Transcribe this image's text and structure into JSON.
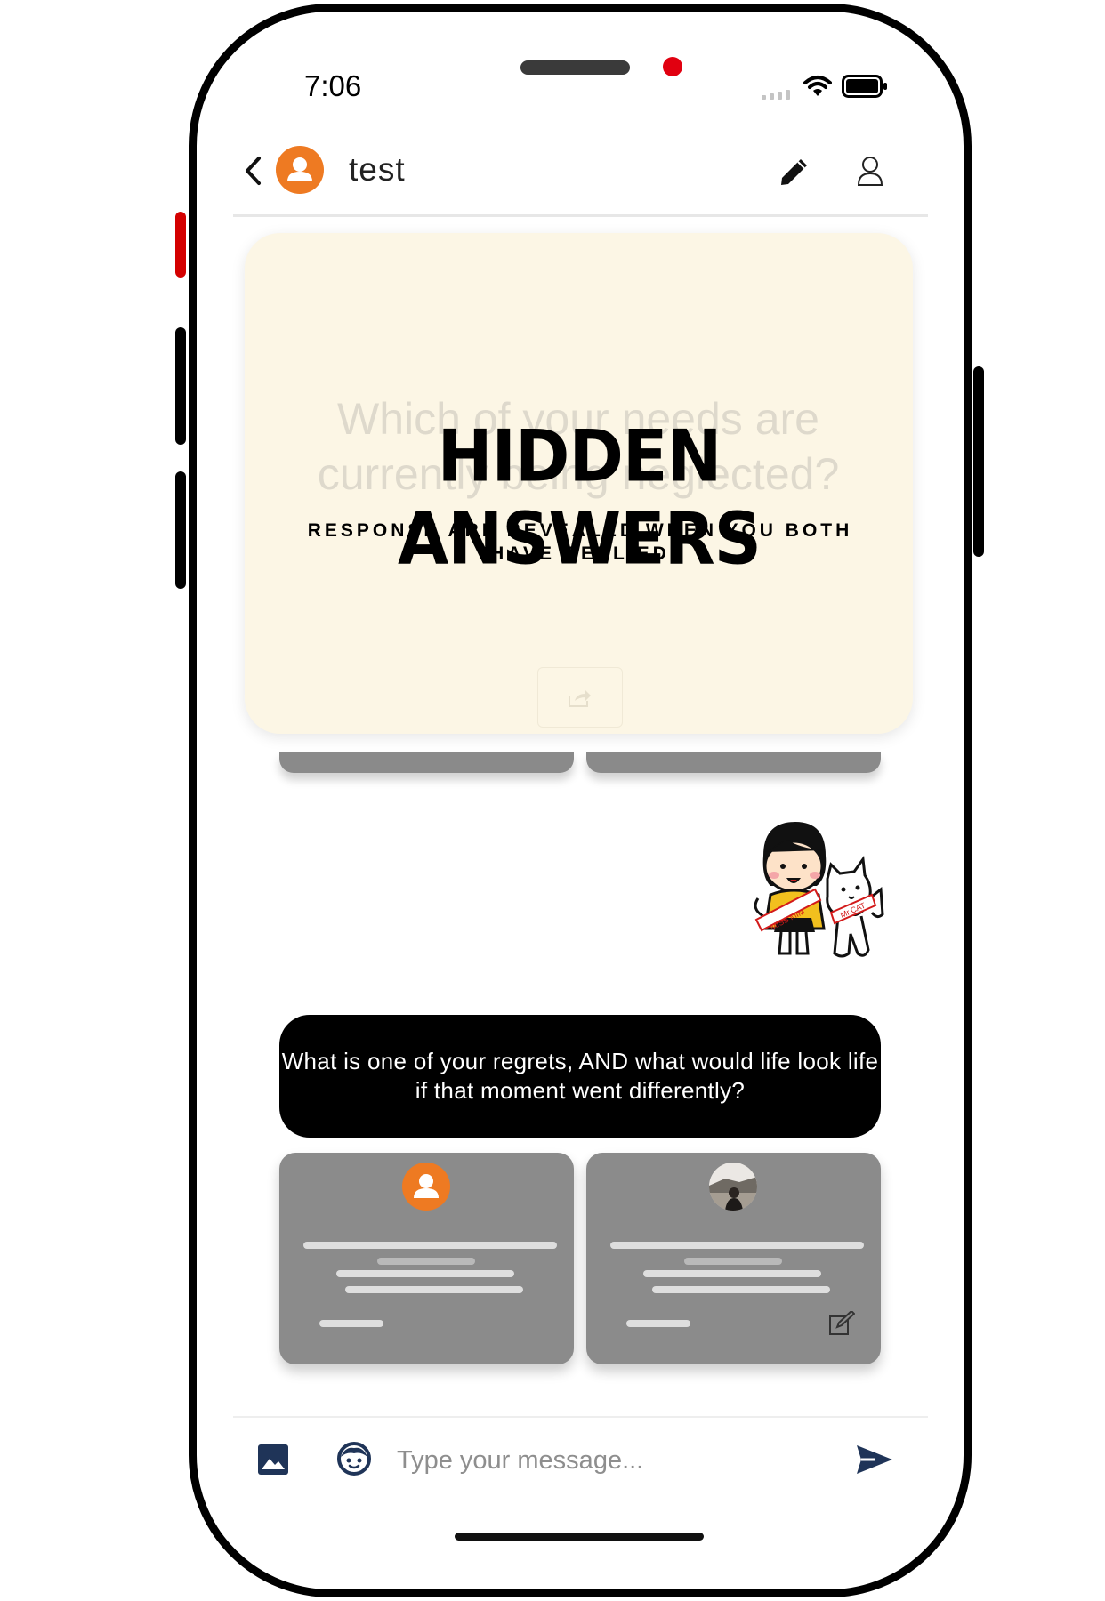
{
  "status_bar": {
    "time": "7:06"
  },
  "header": {
    "chat_title": "test"
  },
  "hidden_card": {
    "ghost_question": "Which of your needs are currently being neglected?",
    "title": "HIDDEN ANSWERS",
    "subtitle": "RESPONSE ARE REVEALED WHEN YOU BOTH HAVE REPLIED"
  },
  "sticker": {
    "label_left": "MISS MIM",
    "label_right": "Mr.CAT"
  },
  "question": {
    "text": "What is one of your regrets, AND what would life look life if that moment went differently?"
  },
  "composer": {
    "placeholder": "Type your message..."
  },
  "colors": {
    "avatar": "#ee7a22",
    "card_bg": "#fcf6e5",
    "send": "#1f3458"
  }
}
